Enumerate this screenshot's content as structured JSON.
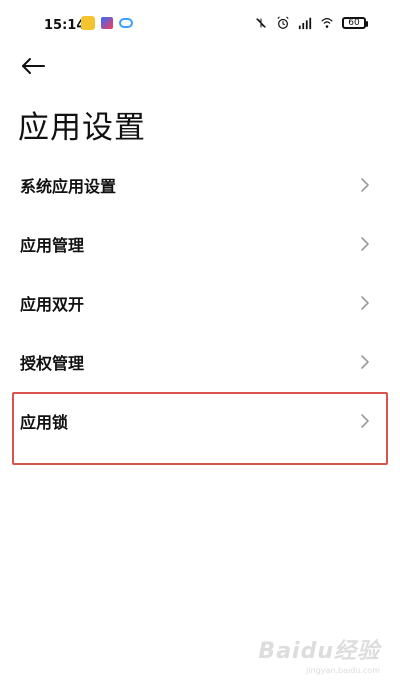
{
  "status_bar": {
    "time": "15:14",
    "battery": "60"
  },
  "header": {
    "title": "应用设置"
  },
  "menu": {
    "items": [
      {
        "label": "系统应用设置"
      },
      {
        "label": "应用管理"
      },
      {
        "label": "应用双开"
      },
      {
        "label": "授权管理"
      },
      {
        "label": "应用锁"
      }
    ]
  },
  "watermark": {
    "logo_text": "Baidu经验",
    "url": "jingyan.baidu.com"
  },
  "icons": {
    "back": "arrow-left-icon",
    "chevron": "chevron-right-icon"
  },
  "colors": {
    "highlight": "#d9534f",
    "chevron": "#9b9b9b"
  }
}
